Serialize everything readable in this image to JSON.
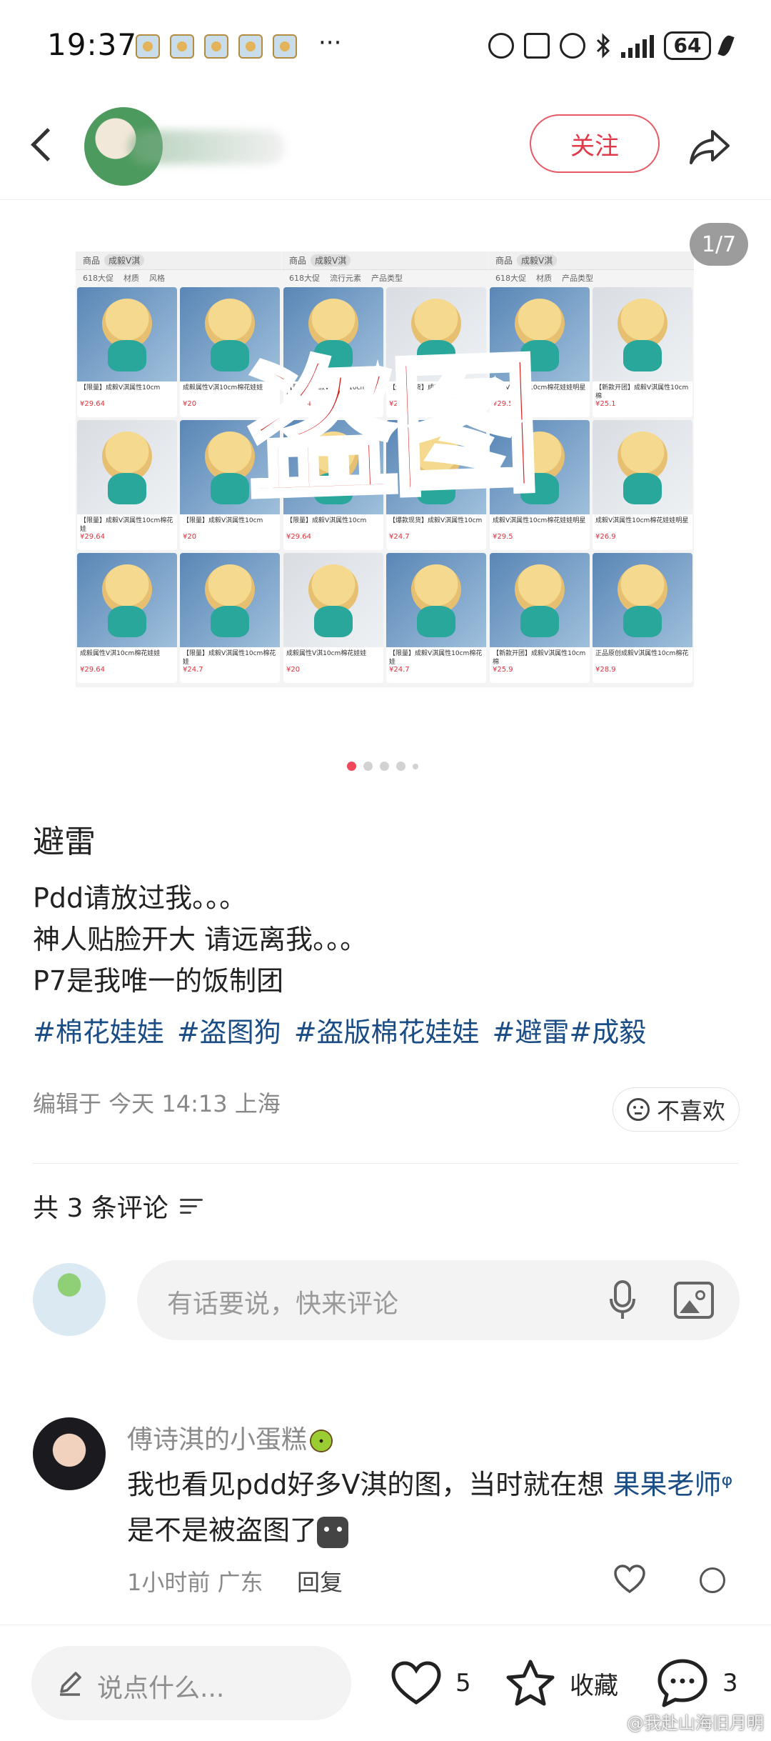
{
  "status_bar": {
    "time": "19:37",
    "overflow": "···",
    "battery": "64"
  },
  "header": {
    "follow_label": "关注"
  },
  "carousel": {
    "counter": "1/7",
    "stamp_text": "盗图",
    "shot_search_label": "商品",
    "shot_search_query": "成毅V淇",
    "shot_filters": [
      "618大促",
      "材质",
      "风格",
      "流行元素",
      "产品类型"
    ],
    "shot_tile_captions": [
      "【限量】成毅V淇属性10cm",
      "成毅属性V淇10cm棉花娃娃",
      "【限量】成毅V淇属性10cm棉花娃",
      "【爆款现货】成毅V淇属性10cm",
      "成毅V淇属性10cm棉花娃娃明星",
      "【新款开团】成毅V淇属性10cm棉",
      "正品原创成毅V淇属性10cm棉花"
    ],
    "shot_prices": [
      "¥29.64",
      "¥20",
      "¥24.7",
      "¥29.5",
      "¥25.1",
      "¥26.9",
      "¥25.9",
      "¥28.9"
    ]
  },
  "post": {
    "title": "避雷",
    "lines": [
      "Pdd请放过我。。。",
      "神人贴脸开大 请远离我。。。",
      "P7是我唯一的饭制团"
    ],
    "tags": [
      "#棉花娃娃",
      "#盗图狗",
      "#盗版棉花娃娃",
      "#避雷#成毅"
    ],
    "meta": "编辑于 今天 14:13 上海",
    "dislike_label": "不喜欢"
  },
  "comments": {
    "count_label": "共 3 条评论",
    "input_placeholder": "有话要说，快来评论",
    "items": [
      {
        "author": "傅诗淇的小蛋糕",
        "text_before": "我也看见pdd好多V淇的图，当时就在想 ",
        "mention": "果果老师",
        "text_after": " 是不是被盗图了",
        "meta": "1小时前 广东",
        "reply_label": "回复"
      }
    ]
  },
  "bottom_bar": {
    "input_placeholder": "说点什么...",
    "like_count": "5",
    "favorite_label": "收藏",
    "comment_count": "3"
  },
  "watermark": "@我赴山海旧月明",
  "colors": {
    "accent_red": "#e03a4a",
    "tag_blue": "#1a4c86",
    "stamp_red": "#d8201e"
  }
}
